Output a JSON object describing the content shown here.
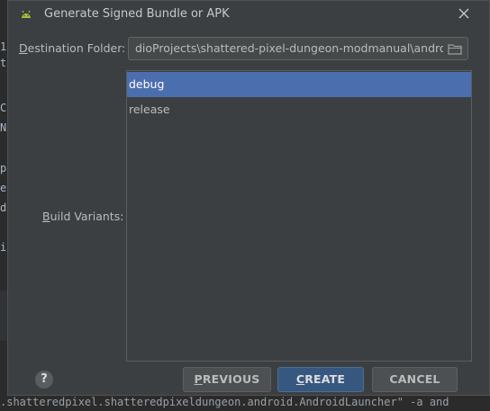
{
  "background": {
    "left_chars": [
      "1",
      "t",
      "t",
      "C",
      "N",
      "p",
      "e",
      "d",
      "i"
    ],
    "bottom_line": ".shatteredpixel.shatteredpixeldungeon.android.AndroidLauncher\" -a and"
  },
  "dialog": {
    "title": "Generate Signed Bundle or APK",
    "title_icon": "android-icon",
    "close_icon": "close-icon"
  },
  "destination": {
    "label_mnemonic": "D",
    "label_rest": "estination Folder:",
    "value": "dioProjects\\shattered-pixel-dungeon-modmanual\\android",
    "browse_icon": "folder-icon"
  },
  "build_variants": {
    "label_mnemonic": "B",
    "label_rest": "uild Variants:",
    "items": [
      {
        "label": "debug",
        "selected": true
      },
      {
        "label": "release",
        "selected": false
      }
    ]
  },
  "footer": {
    "help_label": "?",
    "previous_mnemonic": "P",
    "previous_rest": "REVIOUS",
    "create_mnemonic": "C",
    "create_rest": "REATE",
    "cancel_label": "CANCEL"
  },
  "colors": {
    "dialog_bg": "#3c3f41",
    "selection": "#4b6eaf",
    "primary_button": "#365880",
    "android_green": "#a4c639"
  }
}
